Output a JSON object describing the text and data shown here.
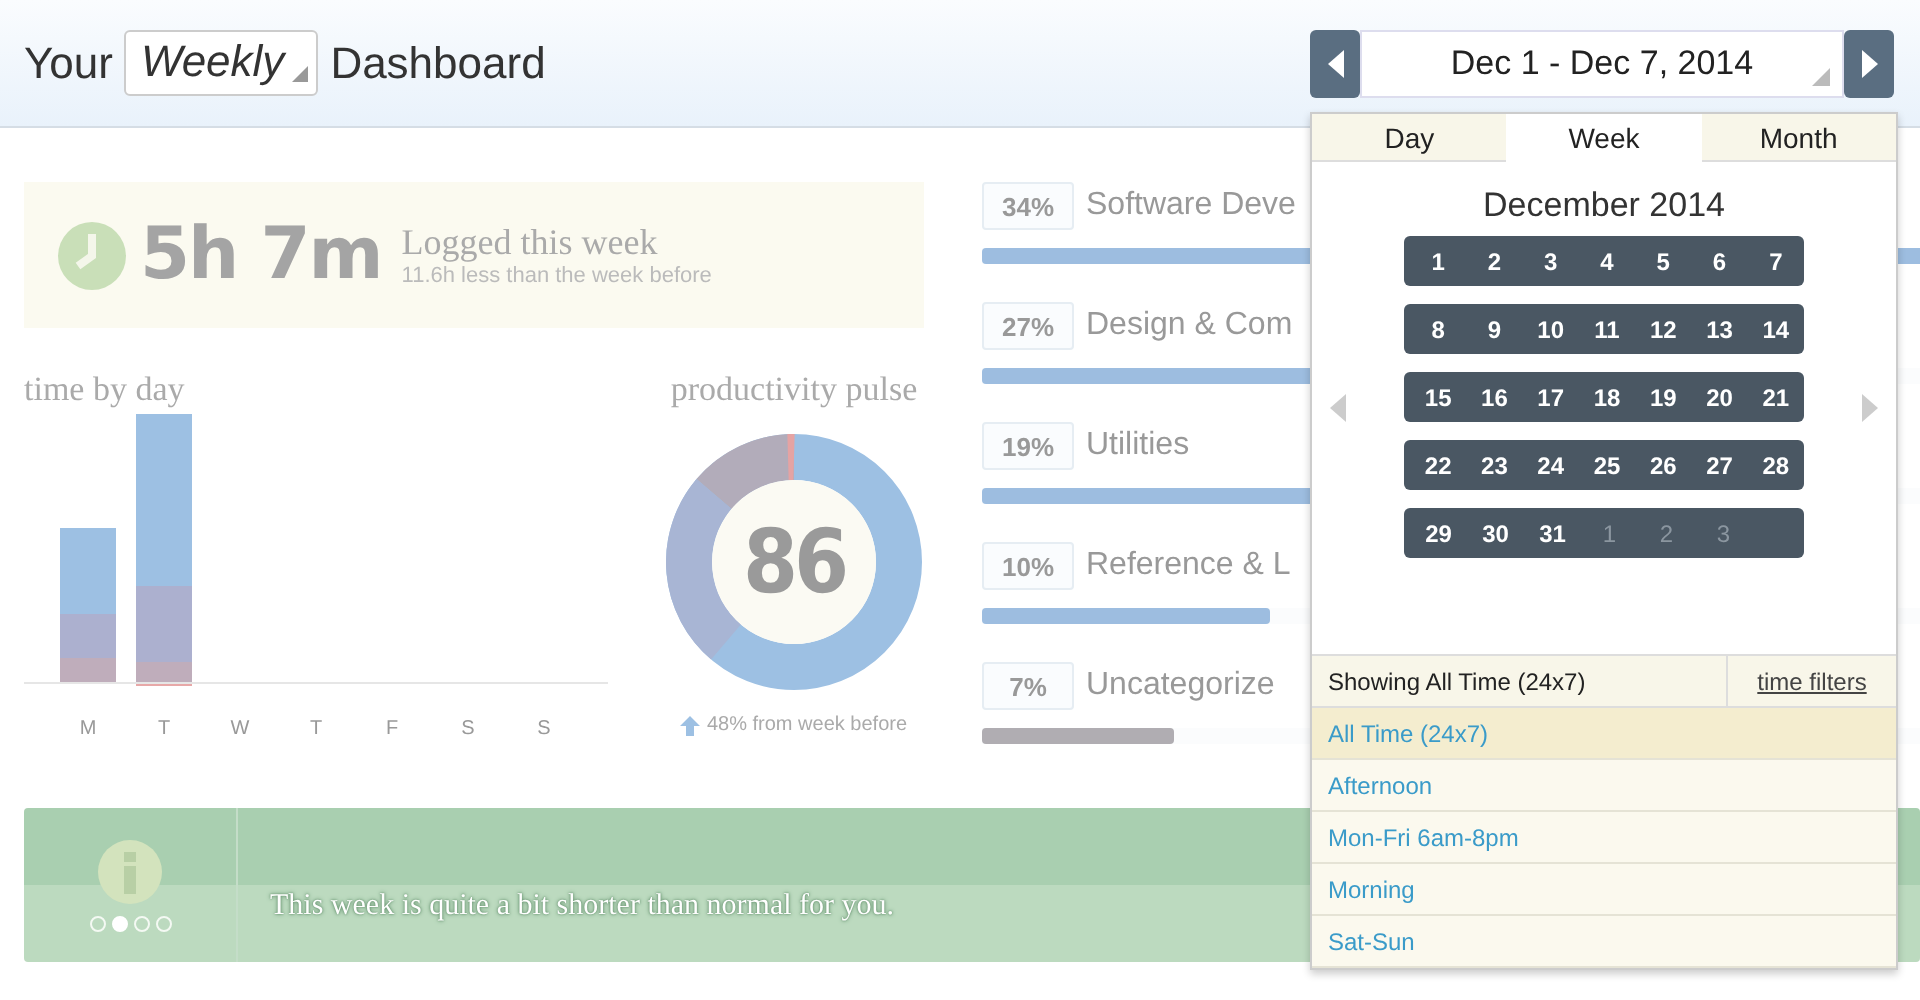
{
  "header": {
    "title_before": "Your",
    "period_select": "Weekly",
    "title_after": "Dashboard",
    "date_range": "Dec 1 - Dec 7, 2014"
  },
  "logged": {
    "total": "5h 7m",
    "label": "Logged this week",
    "note": "11.6h less than the week before"
  },
  "time_by_day": {
    "title": "time by day",
    "days": [
      "M",
      "T",
      "W",
      "T",
      "F",
      "S",
      "S"
    ]
  },
  "productivity_pulse": {
    "title": "productivity pulse",
    "score": "86",
    "change": "48% from week before"
  },
  "categories": [
    {
      "percent": "34%",
      "name": "Software Deve",
      "level": 1.0
    },
    {
      "percent": "27%",
      "name": "Design & Com",
      "level": 0.79
    },
    {
      "percent": "19%",
      "name": "Utilities",
      "level": 0.56
    },
    {
      "percent": "10%",
      "name": "Reference & L",
      "level": 0.3
    },
    {
      "percent": "7%",
      "name": "Uncategorize",
      "level": 0.2
    }
  ],
  "banner": {
    "message": "This week is quite a bit shorter than normal for you.",
    "pages": [
      {
        "selected": false
      },
      {
        "selected": true
      },
      {
        "selected": false
      },
      {
        "selected": false
      }
    ]
  },
  "date_picker": {
    "tabs": [
      {
        "label": "Day",
        "selected": false
      },
      {
        "label": "Week",
        "selected": true
      },
      {
        "label": "Month",
        "selected": false
      }
    ],
    "month": "December 2014",
    "weeks": [
      {
        "days": [
          {
            "label": "1",
            "muted": false
          },
          {
            "label": "2",
            "muted": false
          },
          {
            "label": "3",
            "muted": false
          },
          {
            "label": "4",
            "muted": false
          },
          {
            "label": "5",
            "muted": false
          },
          {
            "label": "6",
            "muted": false
          },
          {
            "label": "7",
            "muted": false
          }
        ]
      },
      {
        "days": [
          {
            "label": "8",
            "muted": false
          },
          {
            "label": "9",
            "muted": false
          },
          {
            "label": "10",
            "muted": false
          },
          {
            "label": "11",
            "muted": false
          },
          {
            "label": "12",
            "muted": false
          },
          {
            "label": "13",
            "muted": false
          },
          {
            "label": "14",
            "muted": false
          }
        ]
      },
      {
        "days": [
          {
            "label": "15",
            "muted": false
          },
          {
            "label": "16",
            "muted": false
          },
          {
            "label": "17",
            "muted": false
          },
          {
            "label": "18",
            "muted": false
          },
          {
            "label": "19",
            "muted": false
          },
          {
            "label": "20",
            "muted": false
          },
          {
            "label": "21",
            "muted": false
          }
        ]
      },
      {
        "days": [
          {
            "label": "22",
            "muted": false
          },
          {
            "label": "23",
            "muted": false
          },
          {
            "label": "24",
            "muted": false
          },
          {
            "label": "25",
            "muted": false
          },
          {
            "label": "26",
            "muted": false
          },
          {
            "label": "27",
            "muted": false
          },
          {
            "label": "28",
            "muted": false
          }
        ]
      },
      {
        "days": [
          {
            "label": "29",
            "muted": false
          },
          {
            "label": "30",
            "muted": false
          },
          {
            "label": "31",
            "muted": false
          },
          {
            "label": "1",
            "muted": true
          },
          {
            "label": "2",
            "muted": true
          },
          {
            "label": "3",
            "muted": true
          }
        ]
      }
    ],
    "showing": "Showing All Time (24x7)",
    "filters_link": "time filters",
    "filters": [
      {
        "label": "All Time (24x7)",
        "selected": true
      },
      {
        "label": "Afternoon",
        "selected": false
      },
      {
        "label": "Mon-Fri 6am-8pm",
        "selected": false
      },
      {
        "label": "Morning",
        "selected": false
      },
      {
        "label": "Sat-Sun",
        "selected": false
      }
    ]
  }
}
